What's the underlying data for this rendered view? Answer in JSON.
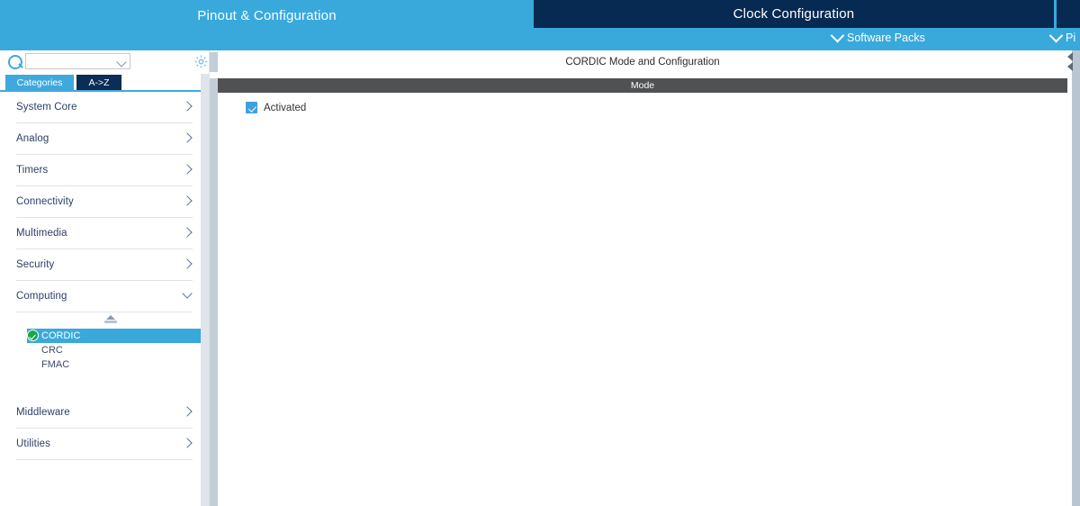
{
  "header": {
    "tabs": [
      {
        "label": "Pinout & Configuration",
        "active": true
      },
      {
        "label": "Clock Configuration",
        "active": false
      }
    ],
    "sub_items": [
      {
        "label": "Software Packs",
        "icon": "chevron-down-icon"
      },
      {
        "label": "Pi",
        "icon": "chevron-down-icon"
      }
    ]
  },
  "sidebar": {
    "search": {
      "value": "",
      "placeholder": "",
      "icon": "search-icon",
      "caret_icon": "chevron-down-icon"
    },
    "settings_icon": "gear-icon",
    "view_tabs": [
      {
        "label": "Categories",
        "active": true
      },
      {
        "label": "A->Z",
        "active": false
      }
    ],
    "categories": [
      {
        "label": "System Core",
        "expanded": false
      },
      {
        "label": "Analog",
        "expanded": false
      },
      {
        "label": "Timers",
        "expanded": false
      },
      {
        "label": "Connectivity",
        "expanded": false
      },
      {
        "label": "Multimedia",
        "expanded": false
      },
      {
        "label": "Security",
        "expanded": false
      },
      {
        "label": "Computing",
        "expanded": true
      }
    ],
    "computing_items": [
      {
        "label": "CORDIC",
        "selected": true,
        "configured": true
      },
      {
        "label": "CRC",
        "selected": false,
        "configured": false
      },
      {
        "label": "FMAC",
        "selected": false,
        "configured": false
      }
    ],
    "categories_bottom": [
      {
        "label": "Middleware",
        "expanded": false
      },
      {
        "label": "Utilities",
        "expanded": false
      }
    ]
  },
  "main": {
    "panel_title": "CORDIC Mode and Configuration",
    "mode_section_title": "Mode",
    "activated": {
      "label": "Activated",
      "checked": true
    }
  },
  "colors": {
    "accent_blue": "#39a9dc",
    "dark_navy": "#072a52",
    "mode_bar_gray": "#4f5153",
    "check_green": "#1aa64b",
    "checkbox_blue": "#3fa0e0"
  }
}
